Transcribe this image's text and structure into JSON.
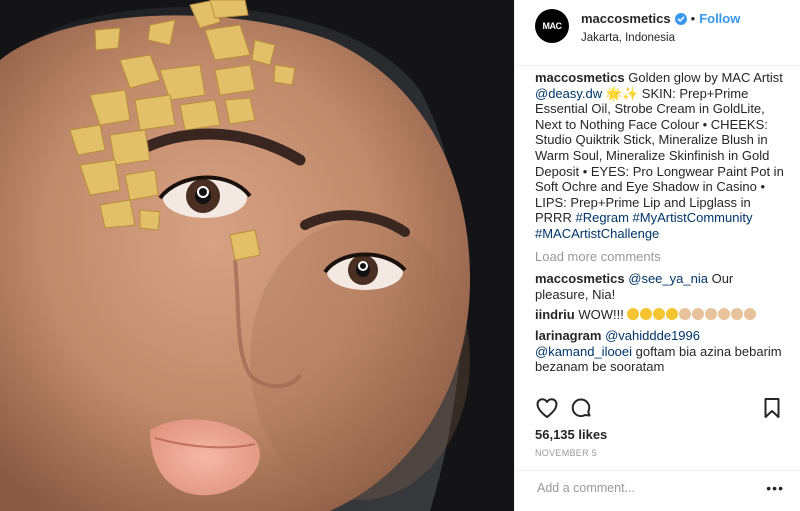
{
  "post": {
    "image_alt": "Close-up portrait with gold leaf on the forehead",
    "account": {
      "username": "maccosmetics",
      "avatar_text": "MAC",
      "verified": true,
      "separator": "•",
      "follow_label": "Follow",
      "location": "Jakarta, Indonesia"
    },
    "caption": {
      "username": "maccosmetics",
      "text_1": "Golden glow by MAC Artist",
      "mention": "@deasy.dw",
      "text_2": "SKIN: Prep+Prime Essential Oil, Strobe Cream in GoldLite, Next to Nothing Face Colour • CHEEKS: Studio Quiktrik Stick, Mineralize Blush in Warm Soul, Mineralize Skinfinish in Gold Deposit • EYES: Pro Longwear Paint Pot in Soft Ochre and Eye Shadow in Casino • LIPS: Prep+Prime Lip and Lipglass in PRRR",
      "hashtags": "#Regram #MyArtistCommunity #MACArtistChallenge"
    },
    "load_more": "Load more comments",
    "comments": [
      {
        "username": "maccosmetics",
        "mention": "@see_ya_nia",
        "text": "Our pleasure, Nia!"
      },
      {
        "username": "iindriu",
        "text": "WOW!!!"
      },
      {
        "username": "larinagram",
        "mention": "@vahiddde1996",
        "mention2": "@kamand_ilooei",
        "text": "goftam bia azina bebarim bezanam be sooratam"
      }
    ],
    "likes": "56,135 likes",
    "date": "NOVEMBER 5",
    "add_comment_placeholder": "Add a comment...",
    "more_label": "•••"
  },
  "icons": [
    "heart-icon",
    "comment-icon",
    "bookmark-icon",
    "verified-badge-icon"
  ],
  "colors": {
    "accent": "#3897f0",
    "link": "#003569",
    "muted": "#999999",
    "text": "#262626",
    "border": "#efefef"
  }
}
